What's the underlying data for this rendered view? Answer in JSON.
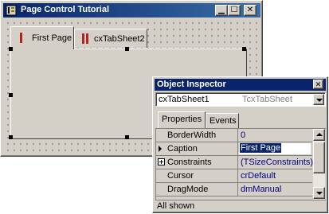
{
  "form": {
    "title": "Page Control Tutorial",
    "tabs": [
      {
        "label": "First Page"
      },
      {
        "label": "cxTabSheet2"
      }
    ]
  },
  "inspector": {
    "title": "Object Inspector",
    "component_name": "cxTabSheet1",
    "component_type": "TcxTabSheet",
    "tabs": [
      {
        "label": "Properties"
      },
      {
        "label": "Events"
      }
    ],
    "properties": [
      {
        "name": "BorderWidth",
        "value": "0"
      },
      {
        "name": "Caption",
        "value": "First Page"
      },
      {
        "name": "Constraints",
        "value": "(TSizeConstraints)"
      },
      {
        "name": "Cursor",
        "value": "crDefault"
      },
      {
        "name": "DragMode",
        "value": "dmManual"
      }
    ],
    "status": "All shown"
  },
  "colors": {
    "titlebar": "#0a246a",
    "face": "#d4d0c8",
    "value_text": "#000080",
    "tab_marker": "#b22222"
  }
}
